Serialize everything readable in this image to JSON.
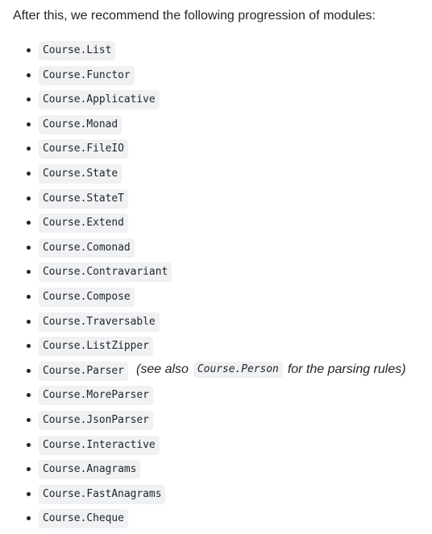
{
  "intro": "After this, we recommend the following progression of modules:",
  "modules": [
    "Course.List",
    "Course.Functor",
    "Course.Applicative",
    "Course.Monad",
    "Course.FileIO",
    "Course.State",
    "Course.StateT",
    "Course.Extend",
    "Course.Comonad",
    "Course.Contravariant",
    "Course.Compose",
    "Course.Traversable",
    "Course.ListZipper",
    "Course.Parser",
    "Course.MoreParser",
    "Course.JsonParser",
    "Course.Interactive",
    "Course.Anagrams",
    "Course.FastAnagrams",
    "Course.Cheque"
  ],
  "parser_note": {
    "before": "(see also",
    "code": "Course.Person",
    "after": "for the parsing rules)"
  }
}
